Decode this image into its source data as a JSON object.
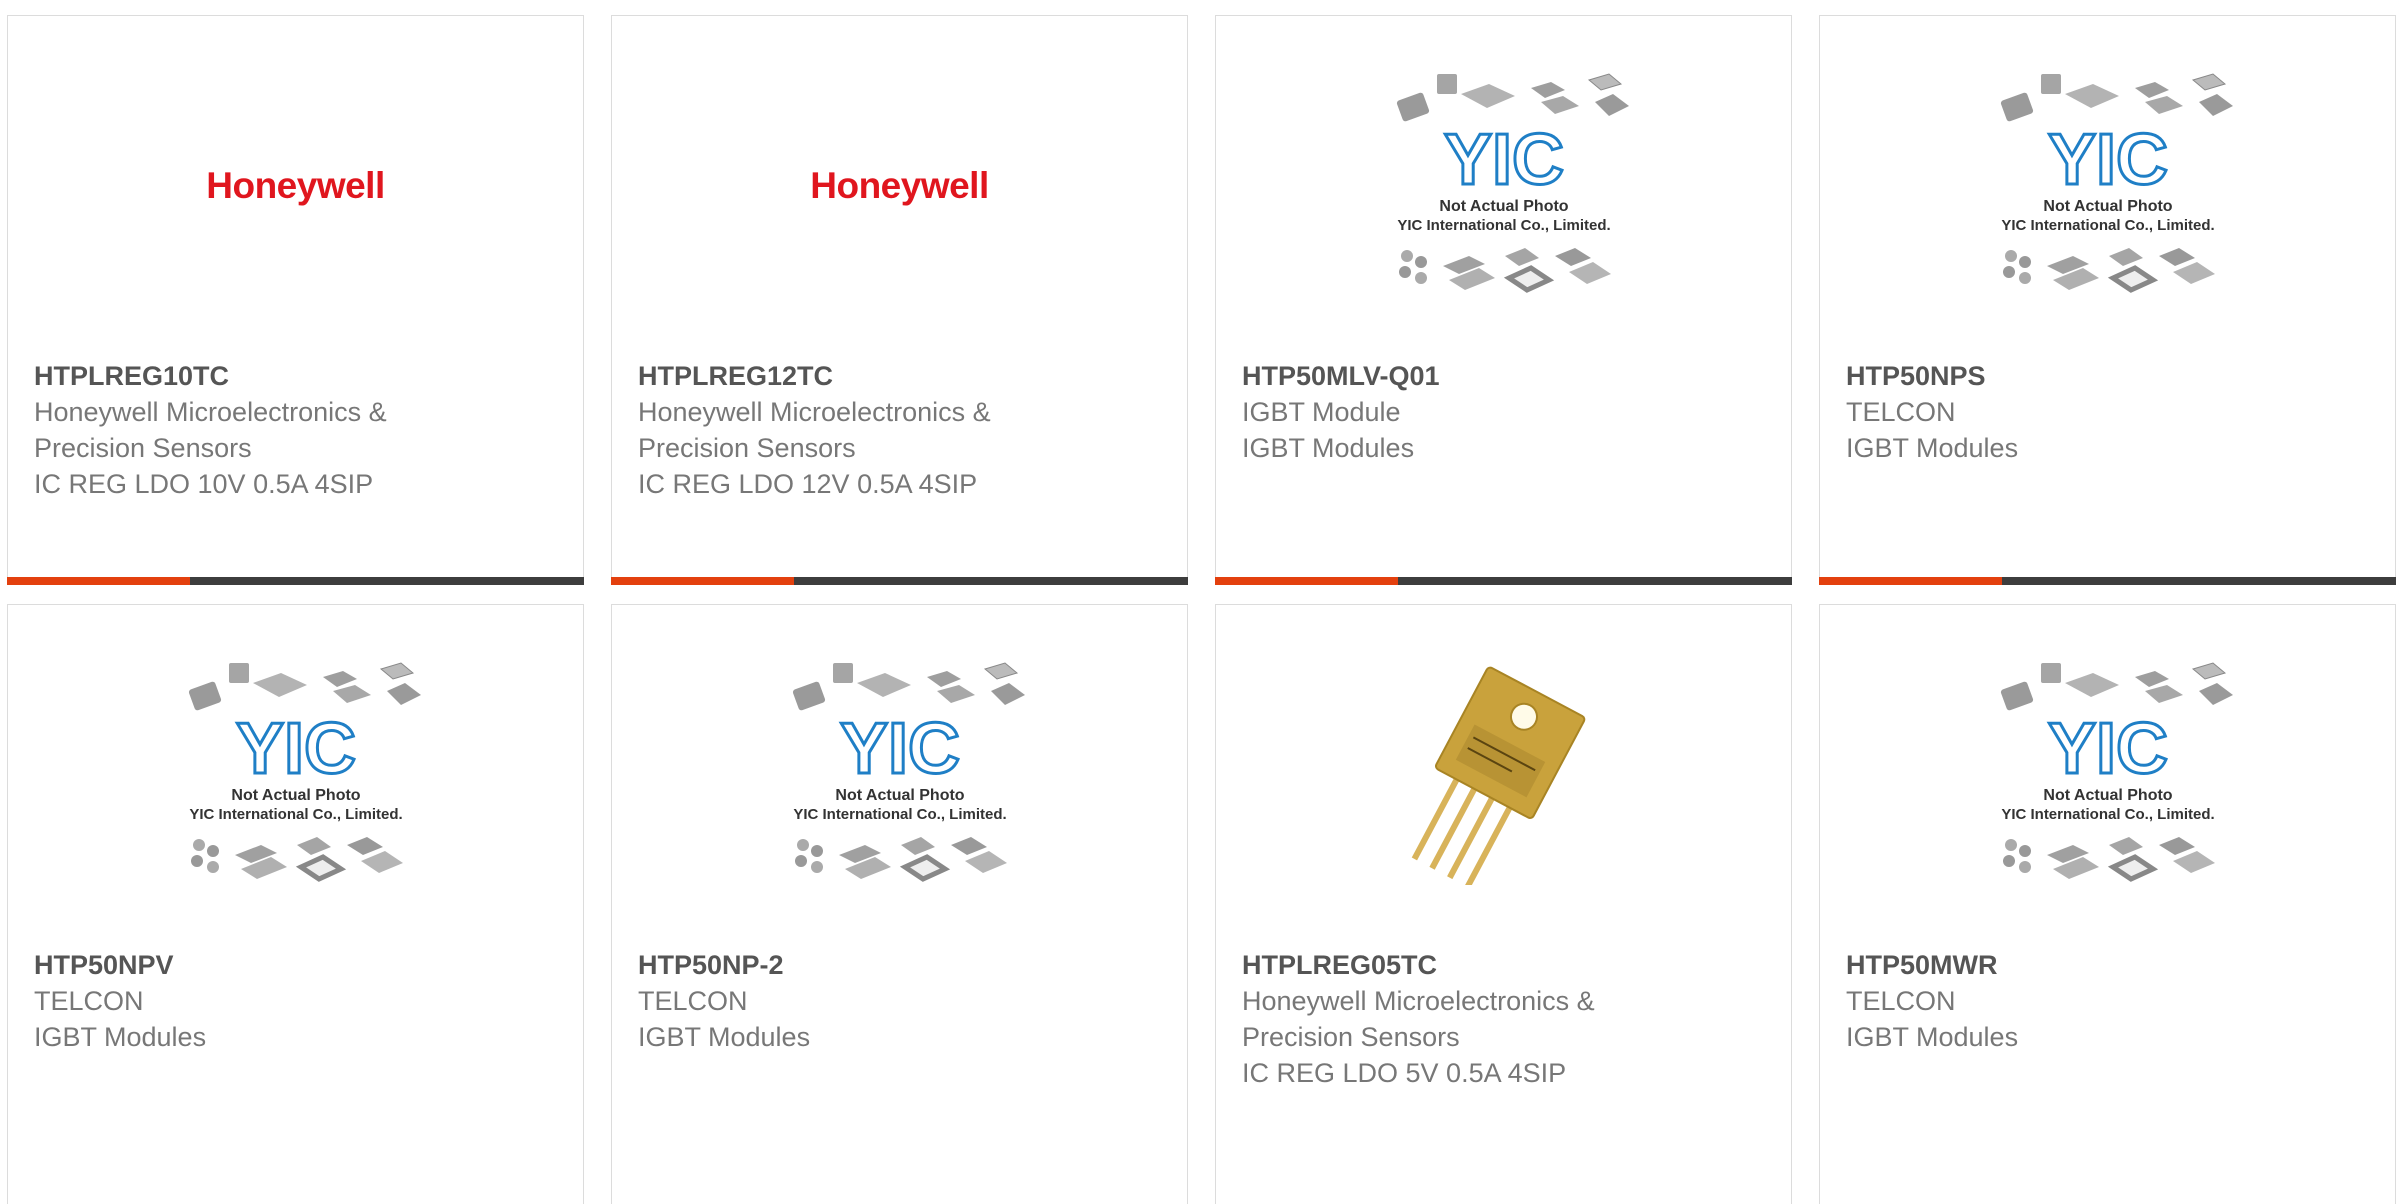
{
  "colors": {
    "accent": "#e3400e",
    "bar": "#3d3d3d",
    "honeywell_red": "#e0161e",
    "yic_blue": "#1f7fc6"
  },
  "placeholder": {
    "logo_text": "YIC",
    "line1": "Not Actual Photo",
    "line2": "YIC International Co., Limited."
  },
  "products": [
    {
      "part": "HTPLREG10TC",
      "mfr": "Honeywell Microelectronics & Precision Sensors",
      "desc": "IC REG LDO 10V 0.5A 4SIP",
      "image": "honeywell-logo",
      "logo_text": "Honeywell"
    },
    {
      "part": "HTPLREG12TC",
      "mfr": "Honeywell Microelectronics & Precision Sensors",
      "desc": "IC REG LDO 12V 0.5A 4SIP",
      "image": "honeywell-logo",
      "logo_text": "Honeywell"
    },
    {
      "part": "HTP50MLV-Q01",
      "mfr": "IGBT Module",
      "desc": "IGBT Modules",
      "image": "yic-placeholder"
    },
    {
      "part": "HTP50NPS",
      "mfr": "TELCON",
      "desc": "IGBT Modules",
      "image": "yic-placeholder"
    },
    {
      "part": "HTP50NPV",
      "mfr": "TELCON",
      "desc": "IGBT Modules",
      "image": "yic-placeholder"
    },
    {
      "part": "HTP50NP-2",
      "mfr": "TELCON",
      "desc": "IGBT Modules",
      "image": "yic-placeholder"
    },
    {
      "part": "HTPLREG05TC",
      "mfr": "Honeywell Microelectronics & Precision Sensors",
      "desc": "IC REG LDO 5V 0.5A 4SIP",
      "image": "component-photo"
    },
    {
      "part": "HTP50MWR",
      "mfr": "TELCON",
      "desc": "IGBT Modules",
      "image": "yic-placeholder"
    }
  ]
}
